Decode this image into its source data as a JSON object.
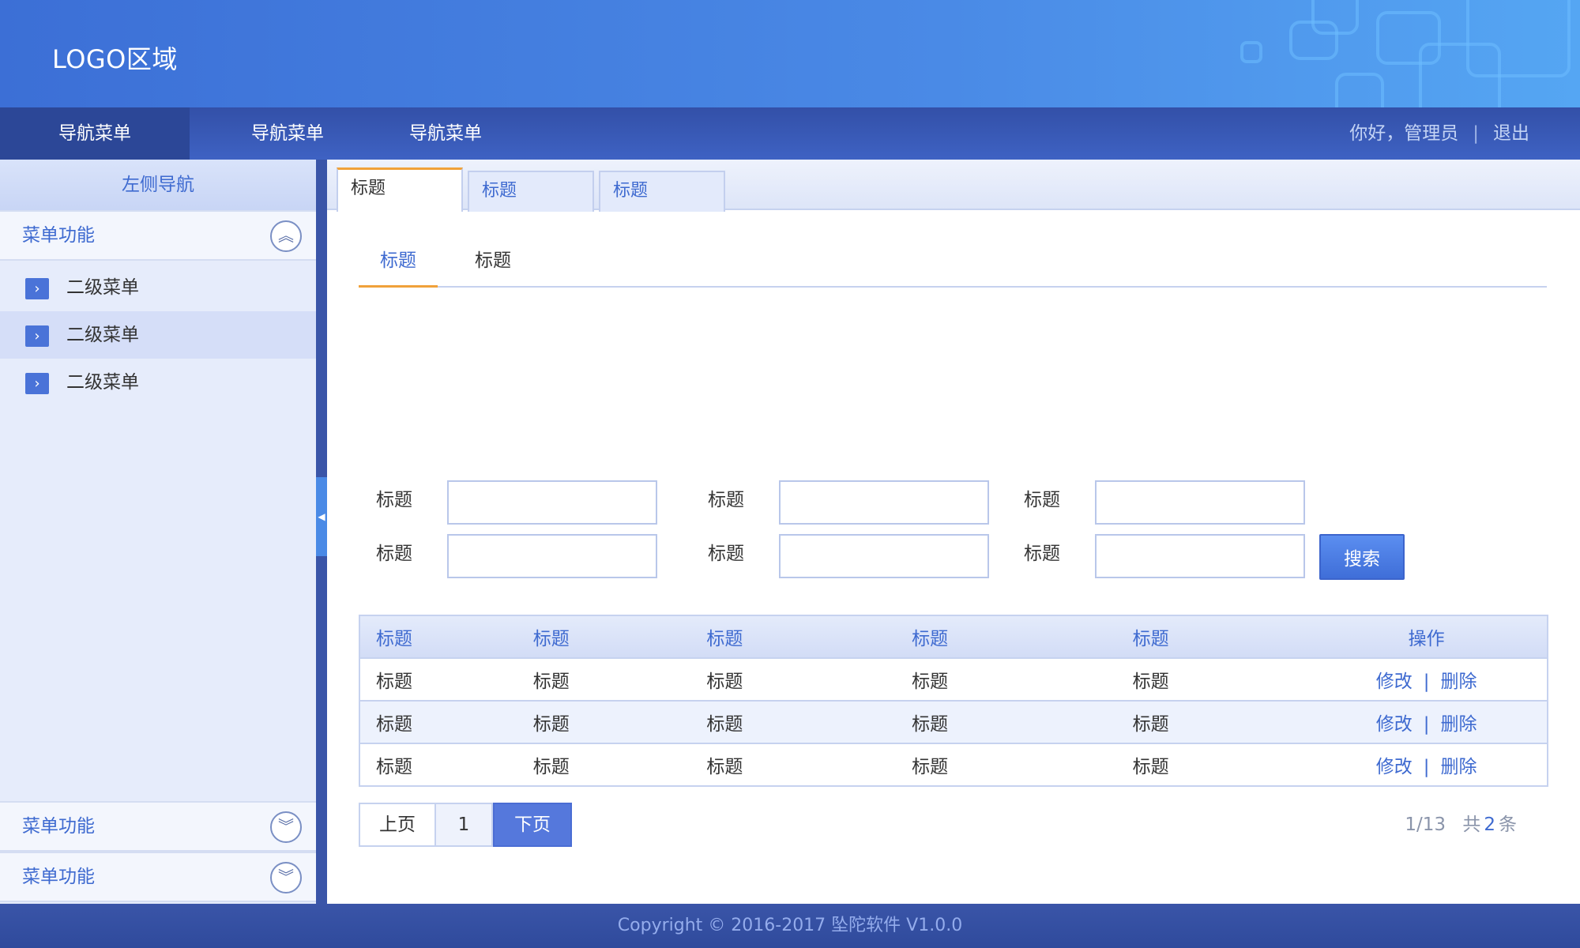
{
  "header": {
    "logo": "LOGO区域"
  },
  "topnav": {
    "items": [
      "导航菜单",
      "导航菜单",
      "导航菜单"
    ],
    "greeting": "你好，管理员",
    "separator": "|",
    "logout": "退出"
  },
  "sidebar": {
    "title": "左侧导航",
    "groups": [
      {
        "label": "菜单功能",
        "expanded": true,
        "icon": "chevron-double-up-icon"
      },
      {
        "label": "菜单功能",
        "expanded": false,
        "icon": "chevron-double-down-icon"
      },
      {
        "label": "菜单功能",
        "expanded": false,
        "icon": "chevron-double-down-icon"
      }
    ],
    "sub_items": [
      "二级菜单",
      "二级菜单",
      "二级菜单"
    ],
    "active_sub_index": 1,
    "item_icon": "arrow-right-icon"
  },
  "tabs": [
    "标题",
    "标题",
    "标题"
  ],
  "subtabs": [
    "标题",
    "标题"
  ],
  "form": {
    "labels": [
      "标题",
      "标题",
      "标题",
      "标题",
      "标题",
      "标题"
    ],
    "values": [
      "",
      "",
      "",
      "",
      "",
      ""
    ],
    "search_label": "搜索"
  },
  "table": {
    "headers": [
      "标题",
      "标题",
      "标题",
      "标题",
      "标题",
      "操作"
    ],
    "rows": [
      [
        "标题",
        "标题",
        "标题",
        "标题",
        "标题"
      ],
      [
        "标题",
        "标题",
        "标题",
        "标题",
        "标题"
      ],
      [
        "标题",
        "标题",
        "标题",
        "标题",
        "标题"
      ]
    ],
    "edit_label": "修改",
    "delete_label": "删除",
    "op_separator": "|"
  },
  "pager": {
    "prev": "上页",
    "page": "1",
    "next": "下页",
    "info": "1/13",
    "total_prefix": "共",
    "total_count": "2",
    "total_suffix": "条"
  },
  "footer": {
    "copyright": "Copyright © 2016-2017 坠陀软件 V1.0.0"
  },
  "colors": {
    "primary": "#3e6ad0",
    "accent": "#f0a13a",
    "nav_bg": "#3350a8",
    "sidebar_bg": "#e6ecfb"
  }
}
